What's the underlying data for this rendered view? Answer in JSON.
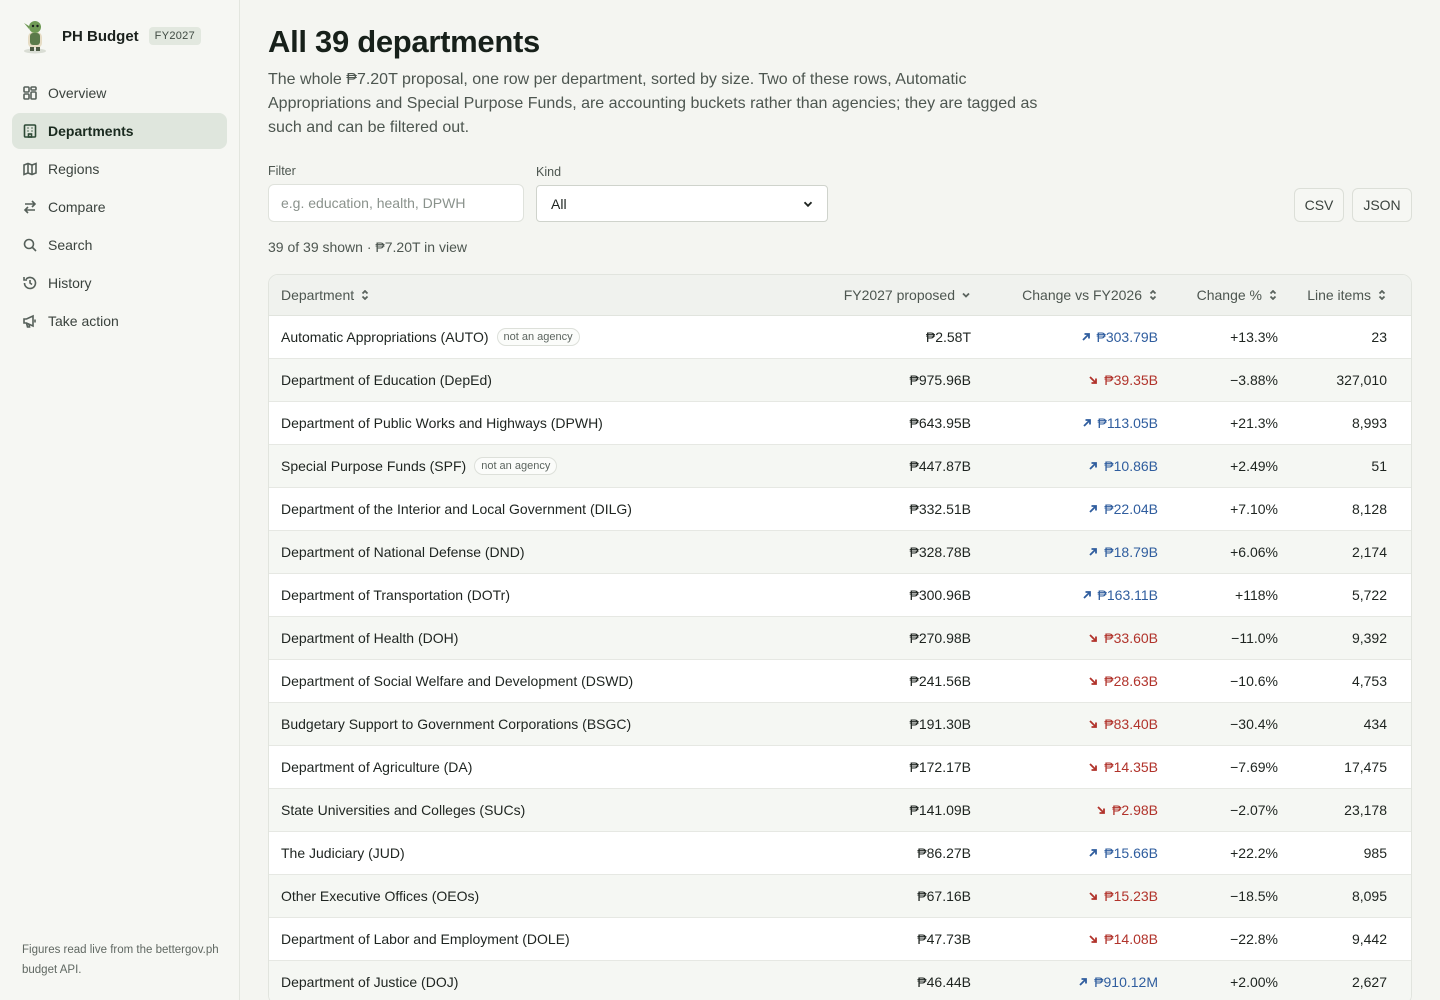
{
  "app": {
    "name": "PH Budget",
    "badge": "FY2027"
  },
  "sidebar": {
    "items": [
      {
        "label": "Overview",
        "icon": "dashboard-icon"
      },
      {
        "label": "Departments",
        "icon": "building-icon",
        "active": true
      },
      {
        "label": "Regions",
        "icon": "map-icon"
      },
      {
        "label": "Compare",
        "icon": "swap-icon"
      },
      {
        "label": "Search",
        "icon": "search-icon"
      },
      {
        "label": "History",
        "icon": "history-icon"
      },
      {
        "label": "Take action",
        "icon": "megaphone-icon"
      }
    ],
    "footer": "Figures read live from the bettergov.ph budget API."
  },
  "page": {
    "title": "All 39 departments",
    "description": "The whole ₱7.20T proposal, one row per department, sorted by size. Two of these rows, Automatic Appropriations and Special Purpose Funds, are accounting buckets rather than agencies; they are tagged as such and can be filtered out."
  },
  "filters": {
    "filter_label": "Filter",
    "filter_placeholder": "e.g. education, health, DPWH",
    "kind_label": "Kind",
    "kind_value": "All",
    "csv_label": "CSV",
    "json_label": "JSON"
  },
  "summary": "39 of 39 shown · ₱7.20T in view",
  "table": {
    "headers": {
      "department": "Department",
      "proposed": "FY2027 proposed",
      "change": "Change vs FY2026",
      "change_pct": "Change %",
      "line_items": "Line items"
    },
    "tag_label": "not an agency",
    "rows": [
      {
        "name": "Automatic Appropriations (AUTO)",
        "tag": true,
        "proposed": "₱2.58T",
        "change": "₱303.79B",
        "dir": "up",
        "pct": "+13.3%",
        "items": "23"
      },
      {
        "name": "Department of Education (DepEd)",
        "tag": false,
        "proposed": "₱975.96B",
        "change": "₱39.35B",
        "dir": "down",
        "pct": "−3.88%",
        "items": "327,010"
      },
      {
        "name": "Department of Public Works and Highways (DPWH)",
        "tag": false,
        "proposed": "₱643.95B",
        "change": "₱113.05B",
        "dir": "up",
        "pct": "+21.3%",
        "items": "8,993"
      },
      {
        "name": "Special Purpose Funds (SPF)",
        "tag": true,
        "proposed": "₱447.87B",
        "change": "₱10.86B",
        "dir": "up",
        "pct": "+2.49%",
        "items": "51"
      },
      {
        "name": "Department of the Interior and Local Government (DILG)",
        "tag": false,
        "proposed": "₱332.51B",
        "change": "₱22.04B",
        "dir": "up",
        "pct": "+7.10%",
        "items": "8,128"
      },
      {
        "name": "Department of National Defense (DND)",
        "tag": false,
        "proposed": "₱328.78B",
        "change": "₱18.79B",
        "dir": "up",
        "pct": "+6.06%",
        "items": "2,174"
      },
      {
        "name": "Department of Transportation (DOTr)",
        "tag": false,
        "proposed": "₱300.96B",
        "change": "₱163.11B",
        "dir": "up",
        "pct": "+118%",
        "items": "5,722"
      },
      {
        "name": "Department of Health (DOH)",
        "tag": false,
        "proposed": "₱270.98B",
        "change": "₱33.60B",
        "dir": "down",
        "pct": "−11.0%",
        "items": "9,392"
      },
      {
        "name": "Department of Social Welfare and Development (DSWD)",
        "tag": false,
        "proposed": "₱241.56B",
        "change": "₱28.63B",
        "dir": "down",
        "pct": "−10.6%",
        "items": "4,753"
      },
      {
        "name": "Budgetary Support to Government Corporations (BSGC)",
        "tag": false,
        "proposed": "₱191.30B",
        "change": "₱83.40B",
        "dir": "down",
        "pct": "−30.4%",
        "items": "434"
      },
      {
        "name": "Department of Agriculture (DA)",
        "tag": false,
        "proposed": "₱172.17B",
        "change": "₱14.35B",
        "dir": "down",
        "pct": "−7.69%",
        "items": "17,475"
      },
      {
        "name": "State Universities and Colleges (SUCs)",
        "tag": false,
        "proposed": "₱141.09B",
        "change": "₱2.98B",
        "dir": "down",
        "pct": "−2.07%",
        "items": "23,178"
      },
      {
        "name": "The Judiciary (JUD)",
        "tag": false,
        "proposed": "₱86.27B",
        "change": "₱15.66B",
        "dir": "up",
        "pct": "+22.2%",
        "items": "985"
      },
      {
        "name": "Other Executive Offices (OEOs)",
        "tag": false,
        "proposed": "₱67.16B",
        "change": "₱15.23B",
        "dir": "down",
        "pct": "−18.5%",
        "items": "8,095"
      },
      {
        "name": "Department of Labor and Employment (DOLE)",
        "tag": false,
        "proposed": "₱47.73B",
        "change": "₱14.08B",
        "dir": "down",
        "pct": "−22.8%",
        "items": "9,442"
      },
      {
        "name": "Department of Justice (DOJ)",
        "tag": false,
        "proposed": "₱46.44B",
        "change": "₱910.12M",
        "dir": "up",
        "pct": "+2.00%",
        "items": "2,627"
      }
    ]
  },
  "colors": {
    "accent_up": "#2f5d9e",
    "accent_down": "#b1332b",
    "active_nav": "#dfe6dd"
  }
}
